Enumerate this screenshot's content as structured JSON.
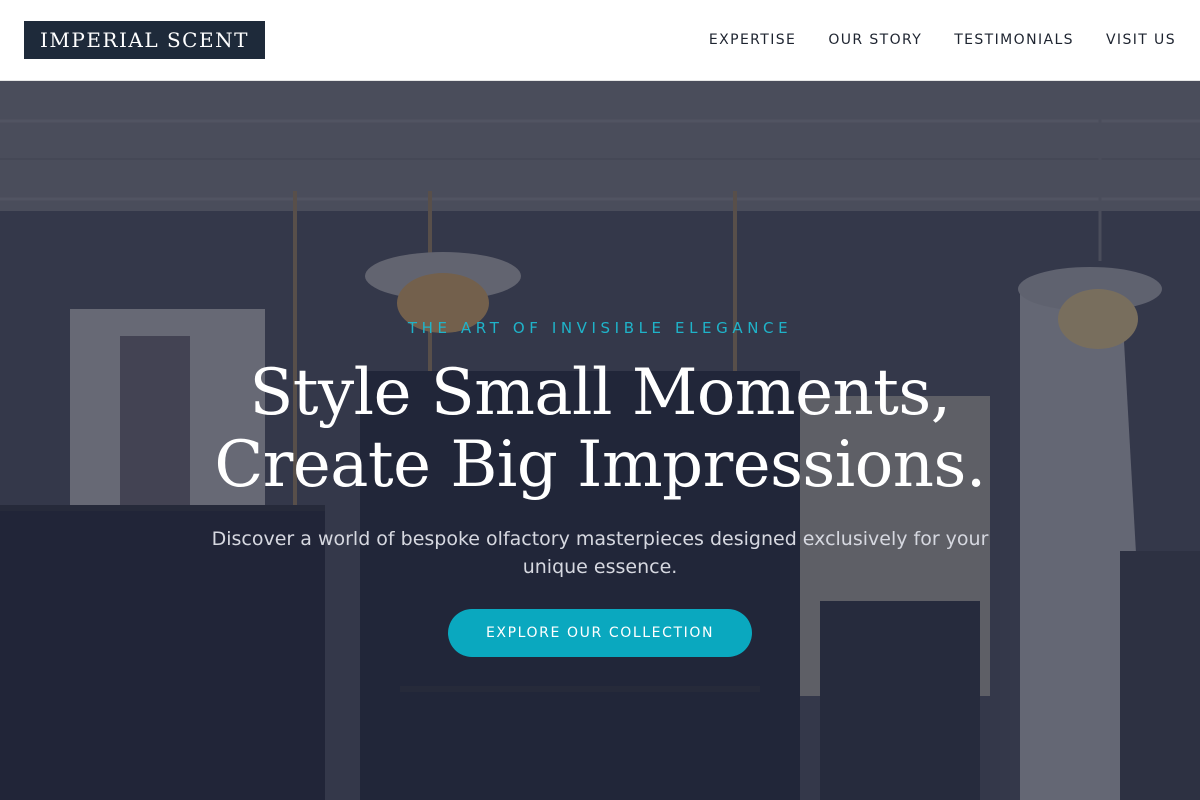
{
  "brand": {
    "name": "IMPERIAL SCENT"
  },
  "nav": {
    "items": [
      {
        "label": "EXPERTISE"
      },
      {
        "label": "OUR STORY"
      },
      {
        "label": "TESTIMONIALS"
      },
      {
        "label": "VISIT US"
      }
    ]
  },
  "hero": {
    "kicker": "THE ART OF INVISIBLE ELEGANCE",
    "headline_line1": "Style Small Moments,",
    "headline_line2": "Create Big Impressions.",
    "subtext": "Discover a world of bespoke olfactory masterpieces designed exclusively for your unique essence.",
    "cta_label": "EXPLORE OUR COLLECTION"
  },
  "colors": {
    "brand_navy": "#1e2a3a",
    "accent_teal": "#0aa8bf"
  }
}
